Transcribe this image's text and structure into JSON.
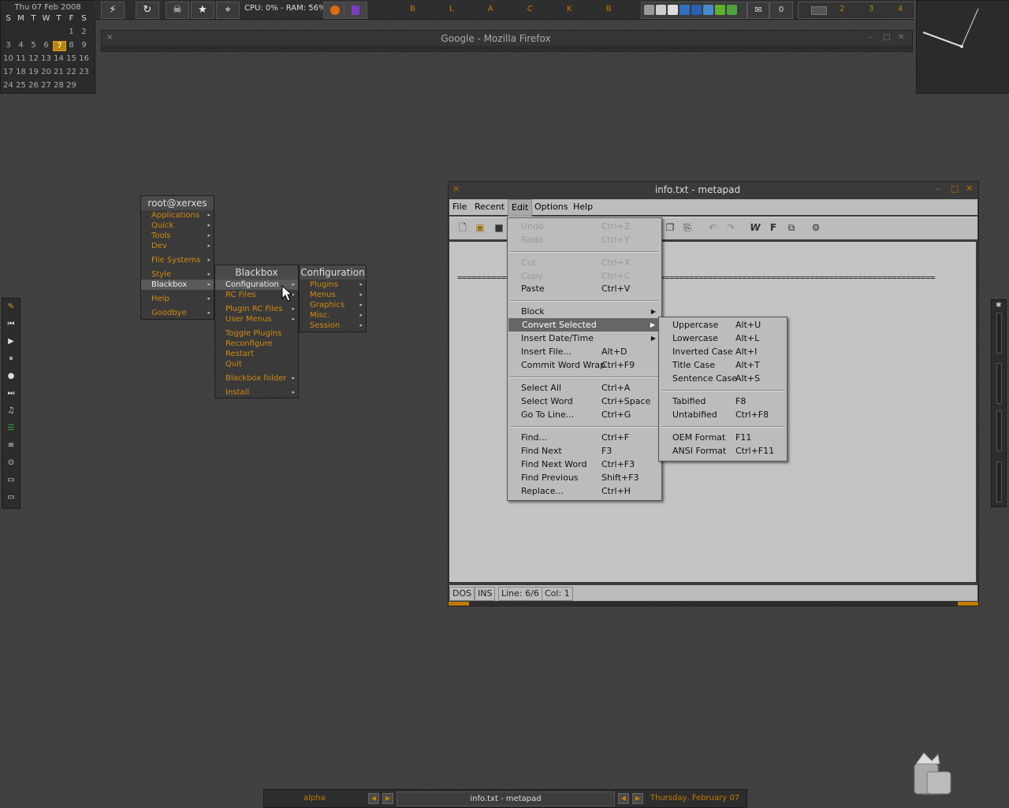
{
  "calendar": {
    "title": "Thu 07 Feb 2008",
    "weekdays": [
      "S",
      "M",
      "T",
      "W",
      "T",
      "F",
      "S"
    ],
    "weeks": [
      [
        "",
        "",
        "",
        "",
        "",
        "1",
        "2"
      ],
      [
        "3",
        "4",
        "5",
        "6",
        "7",
        "8",
        "9"
      ],
      [
        "10",
        "11",
        "12",
        "13",
        "14",
        "15",
        "16"
      ],
      [
        "17",
        "18",
        "19",
        "20",
        "21",
        "22",
        "23"
      ],
      [
        "24",
        "25",
        "26",
        "27",
        "28",
        "29",
        ""
      ]
    ],
    "today": "7"
  },
  "toolbar": {
    "cpu_ram": "CPU: 0% - RAM: 56%",
    "blackbox_title": "B L A C K B O X",
    "mail_count": "0",
    "workspaces": [
      "2",
      "3",
      "4"
    ]
  },
  "firefox": {
    "title": "Google - Mozilla Firefox"
  },
  "root_menu": {
    "title": "root@xerxes",
    "items": [
      "Applications",
      "Quick",
      "Tools",
      "Dev",
      "File Systems",
      "Style",
      "Blackbox",
      "Help",
      "Goodbye"
    ]
  },
  "blackbox_menu": {
    "title": "Blackbox",
    "items": [
      "Configuration",
      "RC Files",
      "Plugin RC Files",
      "User Menus",
      "Toggle Plugins",
      "Reconfigure",
      "Restart",
      "Quit",
      "Blackbox folder",
      "Install"
    ]
  },
  "config_menu": {
    "title": "Configuration",
    "items": [
      "Plugins",
      "Menus",
      "Graphics",
      "Misc.",
      "Session"
    ]
  },
  "metapad": {
    "title": "info.txt - metapad",
    "menus": [
      "File",
      "Recent",
      "Edit",
      "Options",
      "Help"
    ],
    "text_line": "===================================================================================================",
    "status": {
      "mode": "DOS",
      "ins": "INS",
      "line": "Line: 6/6",
      "col": "Col: 1"
    }
  },
  "edit_menu": {
    "items": [
      {
        "label": "Undo",
        "shortcut": "Ctrl+Z",
        "disabled": true
      },
      {
        "label": "Redo",
        "shortcut": "Ctrl+Y",
        "disabled": true
      },
      {
        "label": "Cut",
        "shortcut": "Ctrl+X",
        "disabled": true
      },
      {
        "label": "Copy",
        "shortcut": "Ctrl+C",
        "disabled": true
      },
      {
        "label": "Paste",
        "shortcut": "Ctrl+V"
      },
      {
        "label": "Block",
        "shortcut": ""
      },
      {
        "label": "Convert Selected",
        "shortcut": ""
      },
      {
        "label": "Insert Date/Time",
        "shortcut": ""
      },
      {
        "label": "Insert File...",
        "shortcut": "Alt+D"
      },
      {
        "label": "Commit Word Wrap",
        "shortcut": "Ctrl+F9"
      },
      {
        "label": "Select All",
        "shortcut": "Ctrl+A"
      },
      {
        "label": "Select Word",
        "shortcut": "Ctrl+Space"
      },
      {
        "label": "Go To Line...",
        "shortcut": "Ctrl+G"
      },
      {
        "label": "Find...",
        "shortcut": "Ctrl+F"
      },
      {
        "label": "Find Next",
        "shortcut": "F3"
      },
      {
        "label": "Find Next Word",
        "shortcut": "Ctrl+F3"
      },
      {
        "label": "Find Previous",
        "shortcut": "Shift+F3"
      },
      {
        "label": "Replace...",
        "shortcut": "Ctrl+H"
      }
    ]
  },
  "convert_menu": {
    "items": [
      {
        "label": "Uppercase",
        "shortcut": "Alt+U"
      },
      {
        "label": "Lowercase",
        "shortcut": "Alt+L"
      },
      {
        "label": "Inverted Case",
        "shortcut": "Alt+I"
      },
      {
        "label": "Title Case",
        "shortcut": "Alt+T"
      },
      {
        "label": "Sentence Case",
        "shortcut": "Alt+S"
      },
      {
        "label": "Tabified",
        "shortcut": "F8"
      },
      {
        "label": "Untabified",
        "shortcut": "Ctrl+F8"
      },
      {
        "label": "OEM Format",
        "shortcut": "F11"
      },
      {
        "label": "ANSI Format",
        "shortcut": "Ctrl+F11"
      }
    ]
  },
  "taskbar": {
    "workspace": "alpha",
    "task": "info.txt - metapad",
    "date": "Thursday, February 07"
  },
  "colors": {
    "accent": "#c07a00"
  }
}
